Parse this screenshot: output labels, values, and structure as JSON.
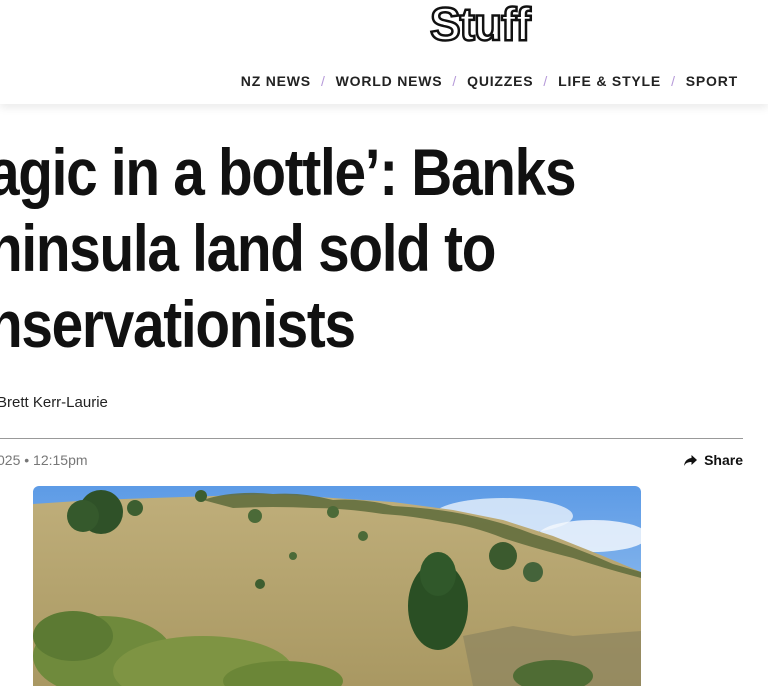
{
  "header": {
    "logo_text": "Stuff",
    "nav": [
      {
        "label": "NZ NEWS"
      },
      {
        "label": "WORLD NEWS"
      },
      {
        "label": "QUIZZES"
      },
      {
        "label": "LIFE & STYLE"
      },
      {
        "label": "SPORT"
      }
    ],
    "nav_separator": "/"
  },
  "article": {
    "headline_lines": [
      "agic in a bottle’: Banks",
      "ninsula land sold to",
      "nservationists"
    ],
    "byline": "Brett Kerr-Laurie",
    "timestamp": "025 • 12:15pm",
    "share_label": "Share",
    "share_icon": "share-arrow-icon",
    "hero_image": "hillside-landscape"
  },
  "colors": {
    "nav_separator": "#b69ad9",
    "text": "#111111",
    "muted": "#777777",
    "sky": "#6ea8e8"
  }
}
